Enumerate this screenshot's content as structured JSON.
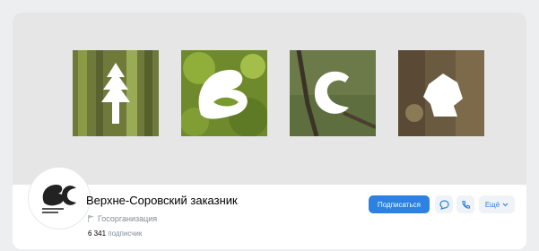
{
  "group": {
    "name": "Верхне-Соровский заказник",
    "category": "Госорганизация",
    "subscribers_count": "6 341",
    "subscribers_label": "подписчик"
  },
  "actions": {
    "subscribe_label": "Подписаться",
    "more_label": "Ещё"
  },
  "colors": {
    "accent": "#2d81e0",
    "cover_background": "#e6e6e7",
    "secondary_text": "#818c99"
  },
  "icons": {
    "category": "flag-icon",
    "message": "message-icon",
    "call": "phone-icon",
    "more": "chevron-down-icon"
  }
}
